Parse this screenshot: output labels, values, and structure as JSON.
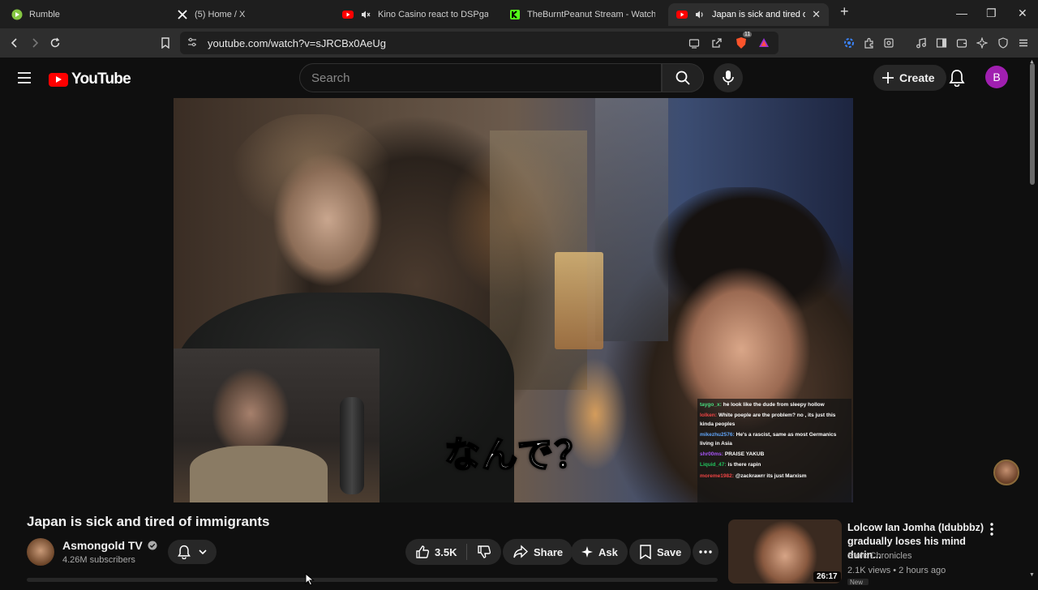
{
  "browser": {
    "tabs": [
      {
        "label": "Rumble",
        "active": false
      },
      {
        "label": "(5) Home / X",
        "active": false
      },
      {
        "label": "Kino Casino react to DSPgaming's",
        "active": false
      },
      {
        "label": "TheBurntPeanut Stream - Watch Live",
        "active": false
      },
      {
        "label": "Japan is sick and tired of imm",
        "active": true
      }
    ],
    "url": "youtube.com/watch?v=sJRCBx0AeUg",
    "brave_badge": "11"
  },
  "header": {
    "logo_text": "YouTube",
    "search_placeholder": "Search",
    "create_label": "Create",
    "avatar_letter": "B"
  },
  "video": {
    "subtitle": "なんで？",
    "chat": [
      {
        "user": "taygo_x:",
        "text": "he look like the dude from sleepy hollow",
        "color": "#4ade80"
      },
      {
        "user": "lolken:",
        "text": "White poeple are the problem? no , its just this kinda peoples",
        "color": "#ef4444"
      },
      {
        "user": "mikezhu2576:",
        "text": "He's a rascist, same as most Germanics living in Asia",
        "color": "#60a5fa"
      },
      {
        "user": "shr00ms:",
        "text": "PRAISE YAKUB",
        "color": "#a855f7"
      },
      {
        "user": "Liquid_47:",
        "text": "is there rapin",
        "color": "#22c55e"
      },
      {
        "user": "moreme1982:",
        "text": "@zackrawrr its just Marxism",
        "color": "#ef4444"
      }
    ]
  },
  "details": {
    "title": "Japan is sick and tired of immigrants",
    "channel": "Asmongold TV",
    "subscribers": "4.26M subscribers",
    "likes": "3.5K",
    "share_label": "Share",
    "ask_label": "Ask",
    "save_label": "Save"
  },
  "recommendation": {
    "title": "Lolcow Ian Jomha (Idubbbz) gradually loses his mind durin...",
    "channel": "Stoic Chronicles",
    "meta": "2.1K views • 2 hours ago",
    "duration": "26:17",
    "badge": "New"
  }
}
